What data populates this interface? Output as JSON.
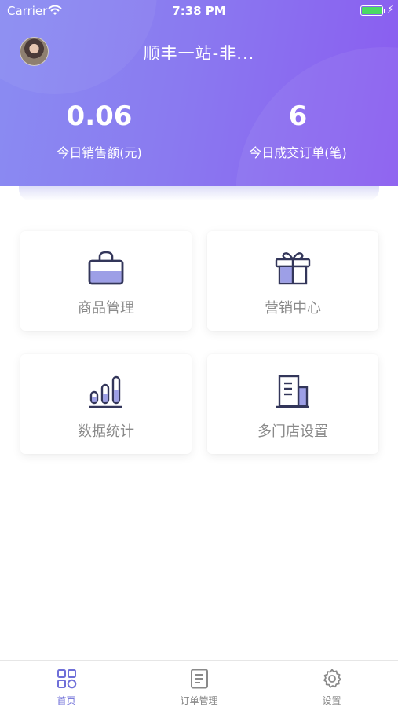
{
  "status_bar": {
    "carrier": "Carrier",
    "time": "7:38 PM",
    "icons": [
      "wifi-icon",
      "battery-icon",
      "charging-icon"
    ]
  },
  "header": {
    "store_name": "顺丰一站-非...",
    "sales": {
      "value": "0.06",
      "label": "今日销售额(元)"
    },
    "orders": {
      "value": "6",
      "label": "今日成交订单(笔)"
    }
  },
  "menu": [
    {
      "label": "商品管理",
      "icon": "shopping-bag-icon"
    },
    {
      "label": "营销中心",
      "icon": "gift-icon"
    },
    {
      "label": "数据统计",
      "icon": "bar-chart-icon"
    },
    {
      "label": "多门店设置",
      "icon": "building-icon"
    }
  ],
  "tabbar": {
    "tabs": [
      {
        "label": "首页",
        "icon": "grid-icon",
        "active": true
      },
      {
        "label": "订单管理",
        "icon": "document-icon",
        "active": false
      },
      {
        "label": "设置",
        "icon": "gear-icon",
        "active": false
      }
    ]
  },
  "colors": {
    "header_gradient_start": "#8a8cf2",
    "header_gradient_end": "#8a5cf0",
    "accent": "#6f6fd8",
    "icon_fill": "#9d9fe6",
    "icon_stroke": "#33365a"
  }
}
